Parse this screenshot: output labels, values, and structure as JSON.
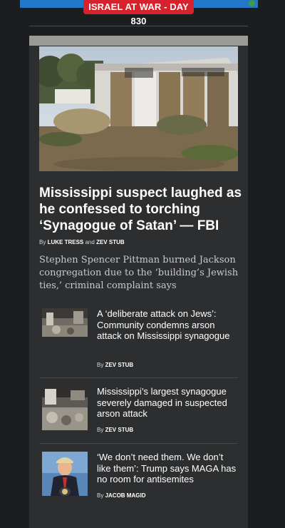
{
  "banner": {
    "label": "ISRAEL AT WAR - DAY 830",
    "accent": "#d5222d",
    "bar_color": "#2277c9"
  },
  "lead": {
    "headline": "Mississippi suspect laughed as he confessed to torching ‘Synagogue of Satan’ — FBI",
    "byline_prefix": "By",
    "authors": [
      "LUKE TRESS",
      "ZEV STUB"
    ],
    "byline_and": "and",
    "summary": "Stephen Spencer Pittman burned Jackson congregation due to the ‘building’s Jewish ties,’ criminal complaint says"
  },
  "stories": [
    {
      "title": "A ‘deliberate attack on Jews’: Community condemns arson attack on Mississippi synagogue",
      "by": "By",
      "author": "ZEV STUB"
    },
    {
      "title": "Mississippi’s largest synagogue severely damaged in suspected arson attack",
      "by": "By",
      "author": "ZEV STUB"
    },
    {
      "title": "‘We don’t need them. We don’t like them’: Trump says MAGA has no room for antisemites",
      "by": "By",
      "author": "JACOB MAGID"
    }
  ]
}
